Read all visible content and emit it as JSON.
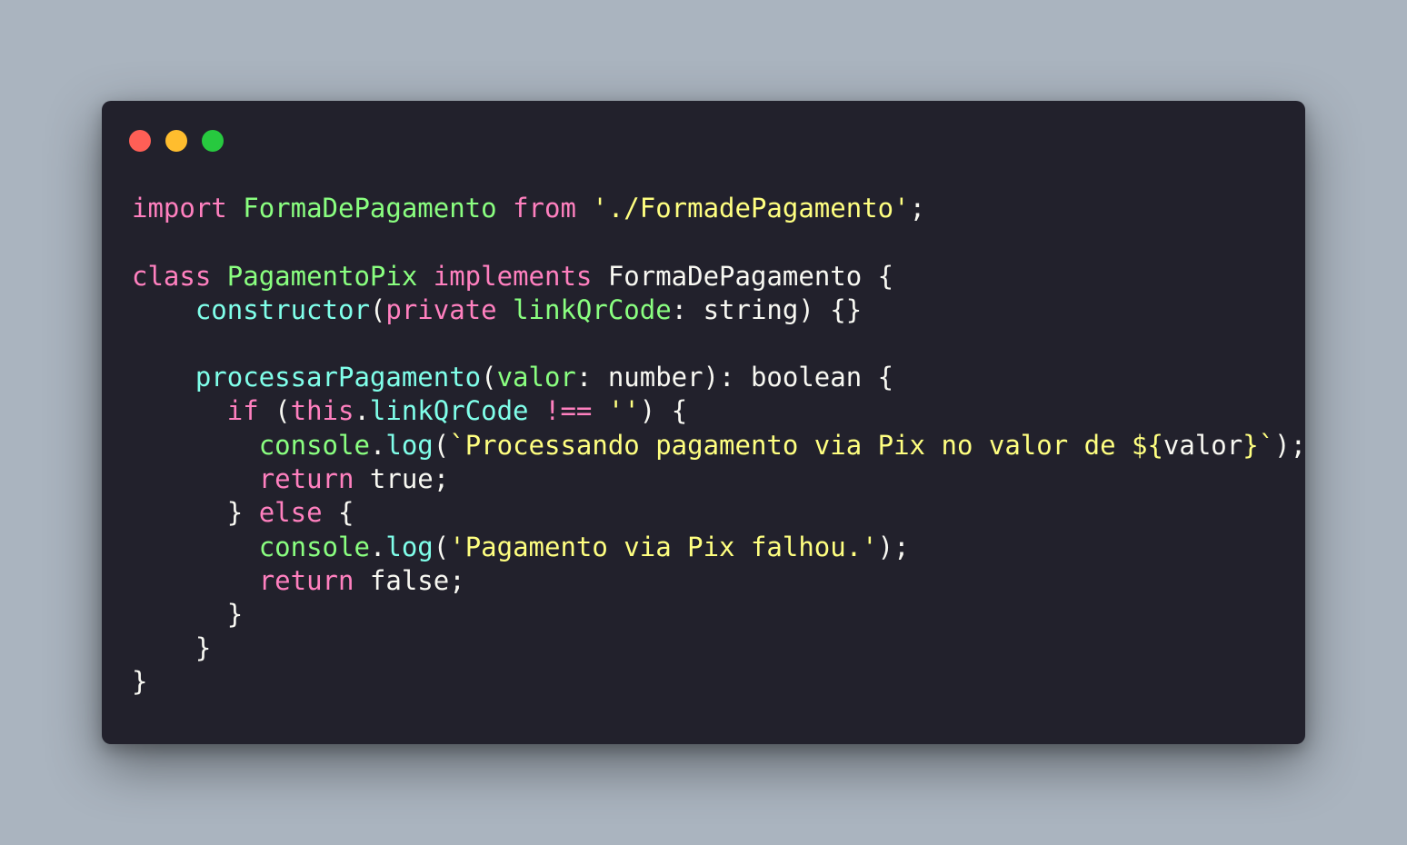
{
  "window": {
    "controls": [
      {
        "name": "close",
        "color": "#ff5f56"
      },
      {
        "name": "minimize",
        "color": "#ffbd2e"
      },
      {
        "name": "maximize",
        "color": "#27c93f"
      }
    ]
  },
  "colors": {
    "background": "#aab4bf",
    "editor": "#22212c",
    "keyword": "#ff80bf",
    "class_name": "#8aff80",
    "function": "#80ffea",
    "string": "#ffff80",
    "plain": "#f8f8f2",
    "punctuation": "#f8f8f2"
  },
  "code": {
    "lines": [
      {
        "indent": "",
        "tokens": [
          {
            "t": "import",
            "k": "keyword"
          },
          {
            "t": " ",
            "k": "plain"
          },
          {
            "t": "FormaDePagamento",
            "k": "class_name"
          },
          {
            "t": " ",
            "k": "plain"
          },
          {
            "t": "from",
            "k": "keyword"
          },
          {
            "t": " ",
            "k": "plain"
          },
          {
            "t": "'./FormadePagamento'",
            "k": "string"
          },
          {
            "t": ";",
            "k": "plain"
          }
        ]
      },
      {
        "indent": "",
        "tokens": []
      },
      {
        "indent": "",
        "tokens": [
          {
            "t": "class",
            "k": "keyword"
          },
          {
            "t": " ",
            "k": "plain"
          },
          {
            "t": "PagamentoPix",
            "k": "class_name"
          },
          {
            "t": " ",
            "k": "plain"
          },
          {
            "t": "implements",
            "k": "keyword"
          },
          {
            "t": " ",
            "k": "plain"
          },
          {
            "t": "FormaDePagamento",
            "k": "plain"
          },
          {
            "t": " {",
            "k": "plain"
          }
        ]
      },
      {
        "indent": "    ",
        "tokens": [
          {
            "t": "constructor",
            "k": "function"
          },
          {
            "t": "(",
            "k": "plain"
          },
          {
            "t": "private",
            "k": "keyword"
          },
          {
            "t": " ",
            "k": "plain"
          },
          {
            "t": "linkQrCode",
            "k": "class_name"
          },
          {
            "t": ": string) {}",
            "k": "plain"
          }
        ]
      },
      {
        "indent": "",
        "tokens": []
      },
      {
        "indent": "    ",
        "tokens": [
          {
            "t": "processarPagamento",
            "k": "function"
          },
          {
            "t": "(",
            "k": "plain"
          },
          {
            "t": "valor",
            "k": "class_name"
          },
          {
            "t": ": number): boolean {",
            "k": "plain"
          }
        ]
      },
      {
        "indent": "      ",
        "tokens": [
          {
            "t": "if",
            "k": "keyword"
          },
          {
            "t": " (",
            "k": "plain"
          },
          {
            "t": "this",
            "k": "keyword"
          },
          {
            "t": ".",
            "k": "plain"
          },
          {
            "t": "linkQrCode",
            "k": "function"
          },
          {
            "t": " ",
            "k": "plain"
          },
          {
            "t": "!==",
            "k": "keyword"
          },
          {
            "t": " ",
            "k": "plain"
          },
          {
            "t": "''",
            "k": "string"
          },
          {
            "t": ") {",
            "k": "plain"
          }
        ]
      },
      {
        "indent": "        ",
        "tokens": [
          {
            "t": "console",
            "k": "class_name"
          },
          {
            "t": ".",
            "k": "plain"
          },
          {
            "t": "log",
            "k": "function"
          },
          {
            "t": "(",
            "k": "plain"
          },
          {
            "t": "`Processando pagamento via Pix no valor de ${",
            "k": "string"
          },
          {
            "t": "valor",
            "k": "plain"
          },
          {
            "t": "}`",
            "k": "string"
          },
          {
            "t": ");",
            "k": "plain"
          }
        ]
      },
      {
        "indent": "        ",
        "tokens": [
          {
            "t": "return",
            "k": "keyword"
          },
          {
            "t": " true;",
            "k": "plain"
          }
        ]
      },
      {
        "indent": "      ",
        "tokens": [
          {
            "t": "} ",
            "k": "plain"
          },
          {
            "t": "else",
            "k": "keyword"
          },
          {
            "t": " {",
            "k": "plain"
          }
        ]
      },
      {
        "indent": "        ",
        "tokens": [
          {
            "t": "console",
            "k": "class_name"
          },
          {
            "t": ".",
            "k": "plain"
          },
          {
            "t": "log",
            "k": "function"
          },
          {
            "t": "(",
            "k": "plain"
          },
          {
            "t": "'Pagamento via Pix falhou.'",
            "k": "string"
          },
          {
            "t": ");",
            "k": "plain"
          }
        ]
      },
      {
        "indent": "        ",
        "tokens": [
          {
            "t": "return",
            "k": "keyword"
          },
          {
            "t": " false;",
            "k": "plain"
          }
        ]
      },
      {
        "indent": "      ",
        "tokens": [
          {
            "t": "}",
            "k": "plain"
          }
        ]
      },
      {
        "indent": "    ",
        "tokens": [
          {
            "t": "}",
            "k": "plain"
          }
        ]
      },
      {
        "indent": "",
        "tokens": [
          {
            "t": "}",
            "k": "plain"
          }
        ]
      }
    ]
  }
}
